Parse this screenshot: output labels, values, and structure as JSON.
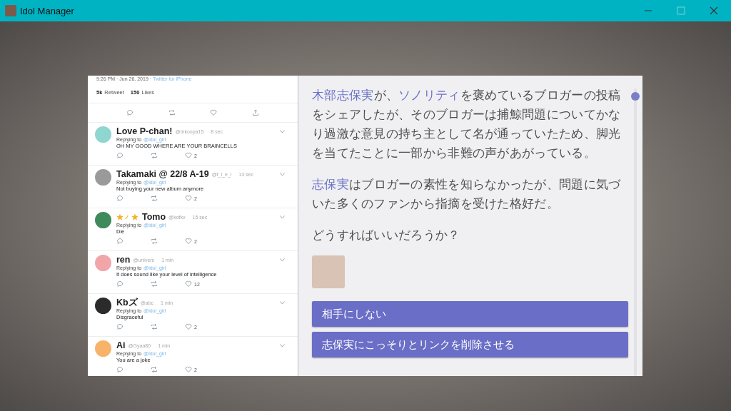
{
  "window": {
    "title": "Idol Manager"
  },
  "tweet_panel": {
    "meta": "9:26 PM · Jun 26, 2019 · ",
    "source": "Twitter for iPhone",
    "retweets": "5k",
    "retweets_label": "Retweet",
    "likes": "150",
    "likes_label": "Likes",
    "replies": [
      {
        "name": "Love P-chan!",
        "handle": "@mkoopa15",
        "time": "8 sec",
        "replying": "Replying to",
        "to": "@idol_girl",
        "text": "OH MY GOOD WHERE ARE YOUR BRAINCELLS",
        "likes": "2",
        "color": "#8fd6d0"
      },
      {
        "name": "Takamaki @ 22/8 A-19",
        "handle": "@f_l_e_l",
        "time": "13 sec",
        "replying": "Replying to",
        "to": "@idol_girl",
        "text": "Not buying your new album anymore",
        "likes": "2",
        "color": "#9a9a9a"
      },
      {
        "name": "Tomo",
        "handle": "@kdfkv",
        "time": "15 sec",
        "replying": "Replying to",
        "to": "@idol_girl",
        "text": "Die",
        "likes": "2",
        "color": "#3f8a5a",
        "stars_prefix": true
      },
      {
        "name": "ren",
        "handle": "@univers",
        "time": "1 min",
        "replying": "Replying to",
        "to": "@idol_girl",
        "text": "It does sound like your level of intelligence",
        "likes": "12",
        "color": "#f2a5a8"
      },
      {
        "name": "Kbズ",
        "handle": "@abc",
        "time": "1 min",
        "replying": "Replying to",
        "to": "@idol_girl",
        "text": "Disgraceful",
        "likes": "2",
        "color": "#2b2b2b"
      },
      {
        "name": "Ai",
        "handle": "@Gyaa80",
        "time": "1 min",
        "replying": "Replying to",
        "to": "@idol_girl",
        "text": "You are a joke",
        "likes": "2",
        "color": "#f7b36a"
      }
    ]
  },
  "story": {
    "paragraphs": [
      [
        {
          "kind": "name",
          "text": "木部志保実"
        },
        {
          "kind": "text",
          "text": "が、"
        },
        {
          "kind": "name",
          "text": "ソノリティ"
        },
        {
          "kind": "text",
          "text": "を褒めているブロガーの投稿をシェアしたが、そのブロガーは捕鯨問題についてかなり過激な意見の持ち主として名が通っていたため、脚光を当てたことに一部から非難の声があがっている。"
        }
      ],
      [
        {
          "kind": "name",
          "text": "志保実"
        },
        {
          "kind": "text",
          "text": "はブロガーの素性を知らなかったが、問題に気づいた多くのファンから指摘を受けた格好だ。"
        }
      ],
      [
        {
          "kind": "text",
          "text": "どうすればいいだろうか？"
        }
      ]
    ],
    "choices": [
      "相手にしない",
      "志保実にこっそりとリンクを削除させる"
    ]
  }
}
